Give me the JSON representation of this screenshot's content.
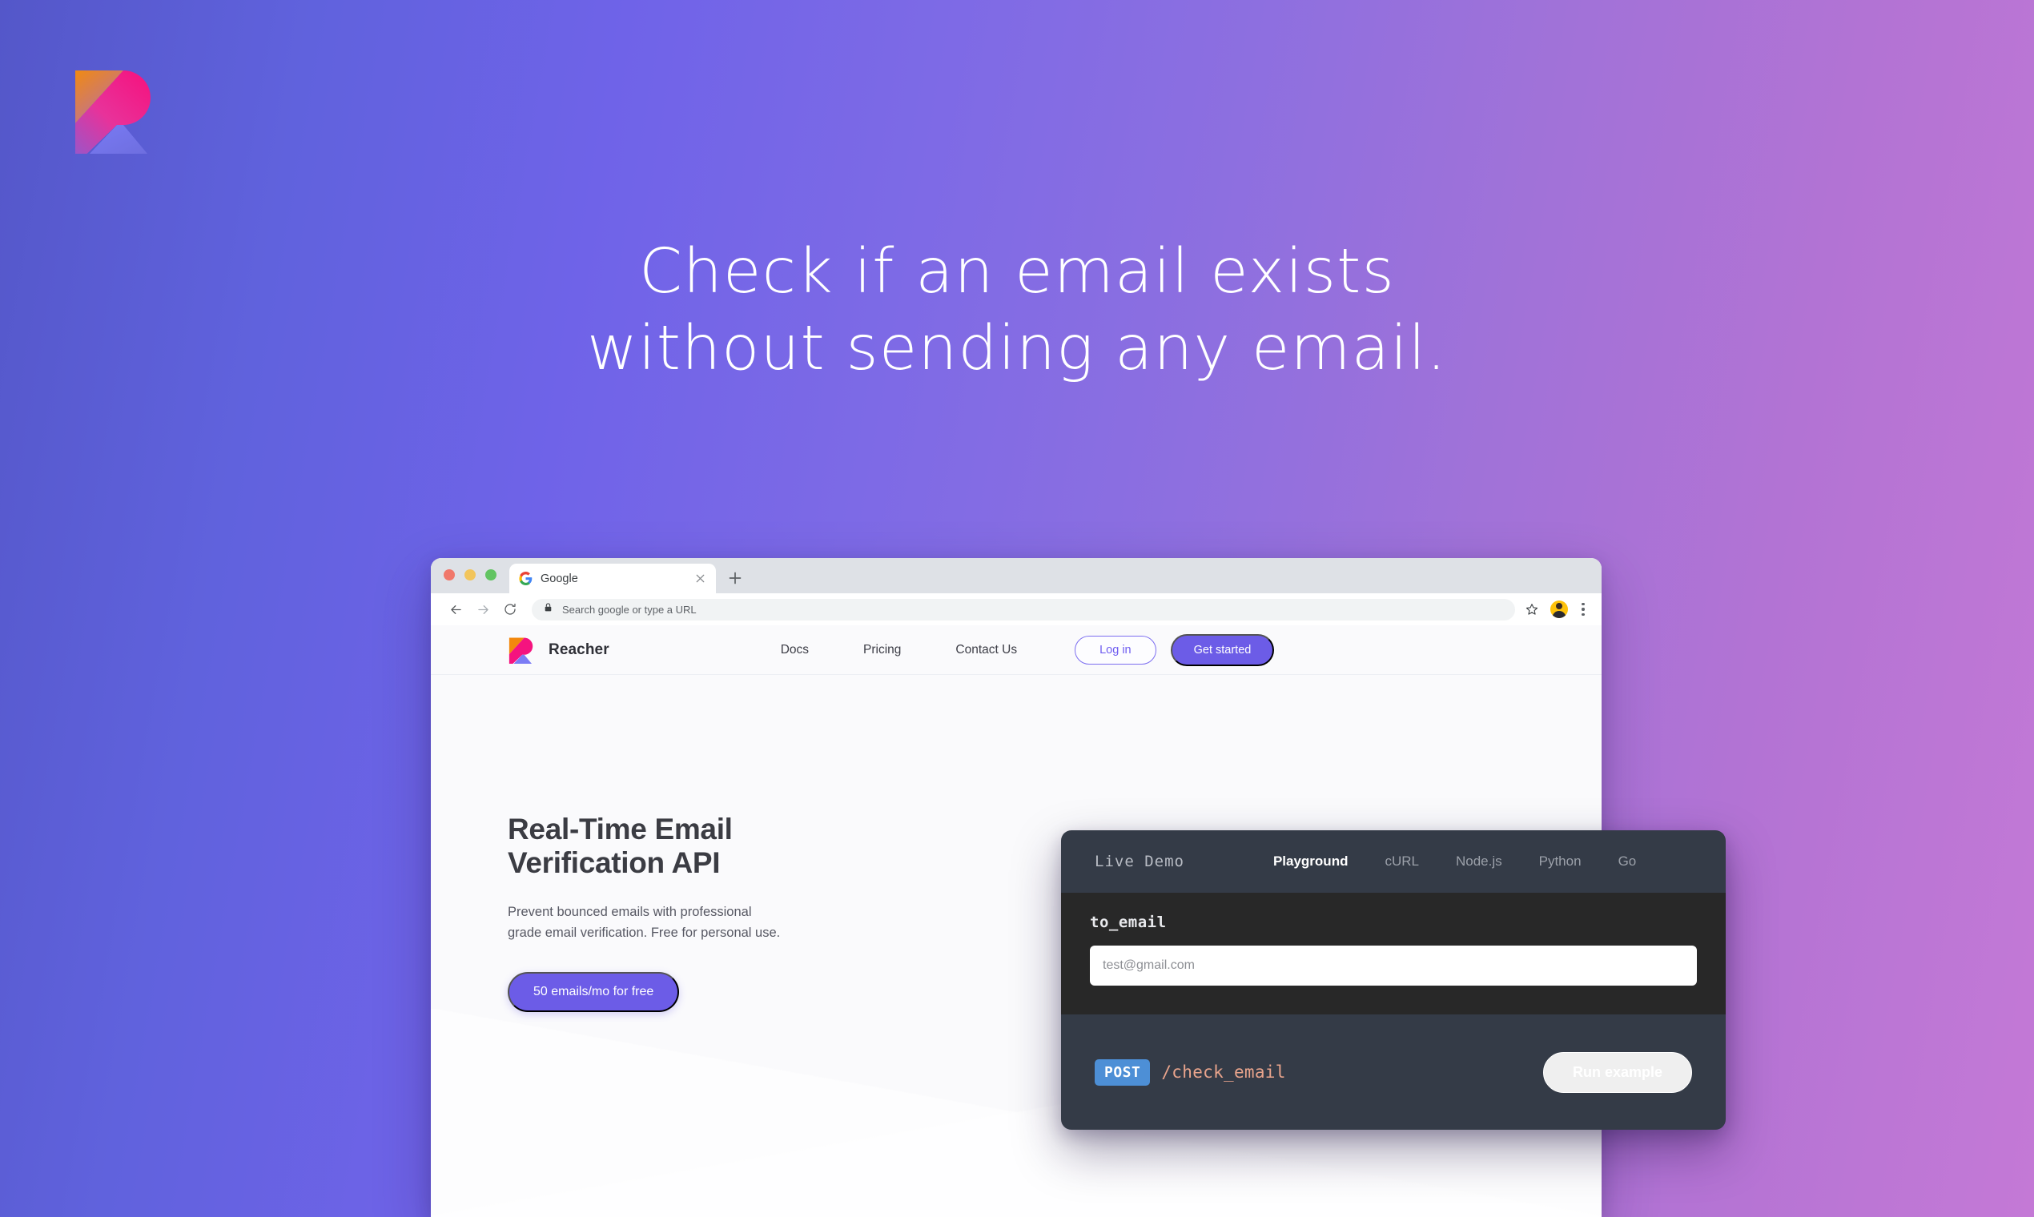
{
  "page": {
    "headline_line1": "Check if an email exists",
    "headline_line2": "without sending any email.",
    "logo_icon": "reacher-logo-icon",
    "bg_gradient_from": "#5457c9",
    "bg_gradient_to": "#c479d6"
  },
  "browser": {
    "traffic_lights": [
      "close-red",
      "minimize-yellow",
      "maximize-green"
    ],
    "tab": {
      "favicon": "google-g-icon",
      "title": "Google",
      "close_icon": "close-icon"
    },
    "new_tab_icon": "plus-icon",
    "toolbar": {
      "back_icon": "arrow-left-icon",
      "forward_icon": "arrow-right-icon",
      "reload_icon": "reload-icon",
      "lock_icon": "lock-icon",
      "omnibox_text": "Search google or type a URL",
      "star_icon": "star-icon",
      "avatar": "user-avatar",
      "menu_icon": "kebab-menu-icon"
    }
  },
  "site": {
    "brand": {
      "logo_icon": "reacher-logo-icon",
      "name": "Reacher"
    },
    "nav_links": [
      {
        "label": "Docs"
      },
      {
        "label": "Pricing"
      },
      {
        "label": "Contact Us"
      }
    ],
    "login_label": "Log in",
    "get_started_label": "Get started",
    "hero": {
      "title_line1": "Real-Time Email",
      "title_line2": "Verification API",
      "subtitle_line1": "Prevent bounced emails with professional",
      "subtitle_line2": "grade email verification. Free for personal use.",
      "cta_label": "50 emails/mo for free",
      "accent_color": "#6c5ce7"
    }
  },
  "demo": {
    "live_demo_label": "Live Demo",
    "tabs": [
      {
        "label": "Playground",
        "active": true
      },
      {
        "label": "cURL",
        "active": false
      },
      {
        "label": "Node.js",
        "active": false
      },
      {
        "label": "Python",
        "active": false
      },
      {
        "label": "Go",
        "active": false
      }
    ],
    "field_label": "to_email",
    "field_placeholder": "test@gmail.com",
    "field_value": "",
    "method": "POST",
    "endpoint": "/check_email",
    "run_label": "Run example",
    "method_color": "#4d8fd6",
    "endpoint_color": "#e9a48c",
    "panel_color": "#343b47"
  }
}
